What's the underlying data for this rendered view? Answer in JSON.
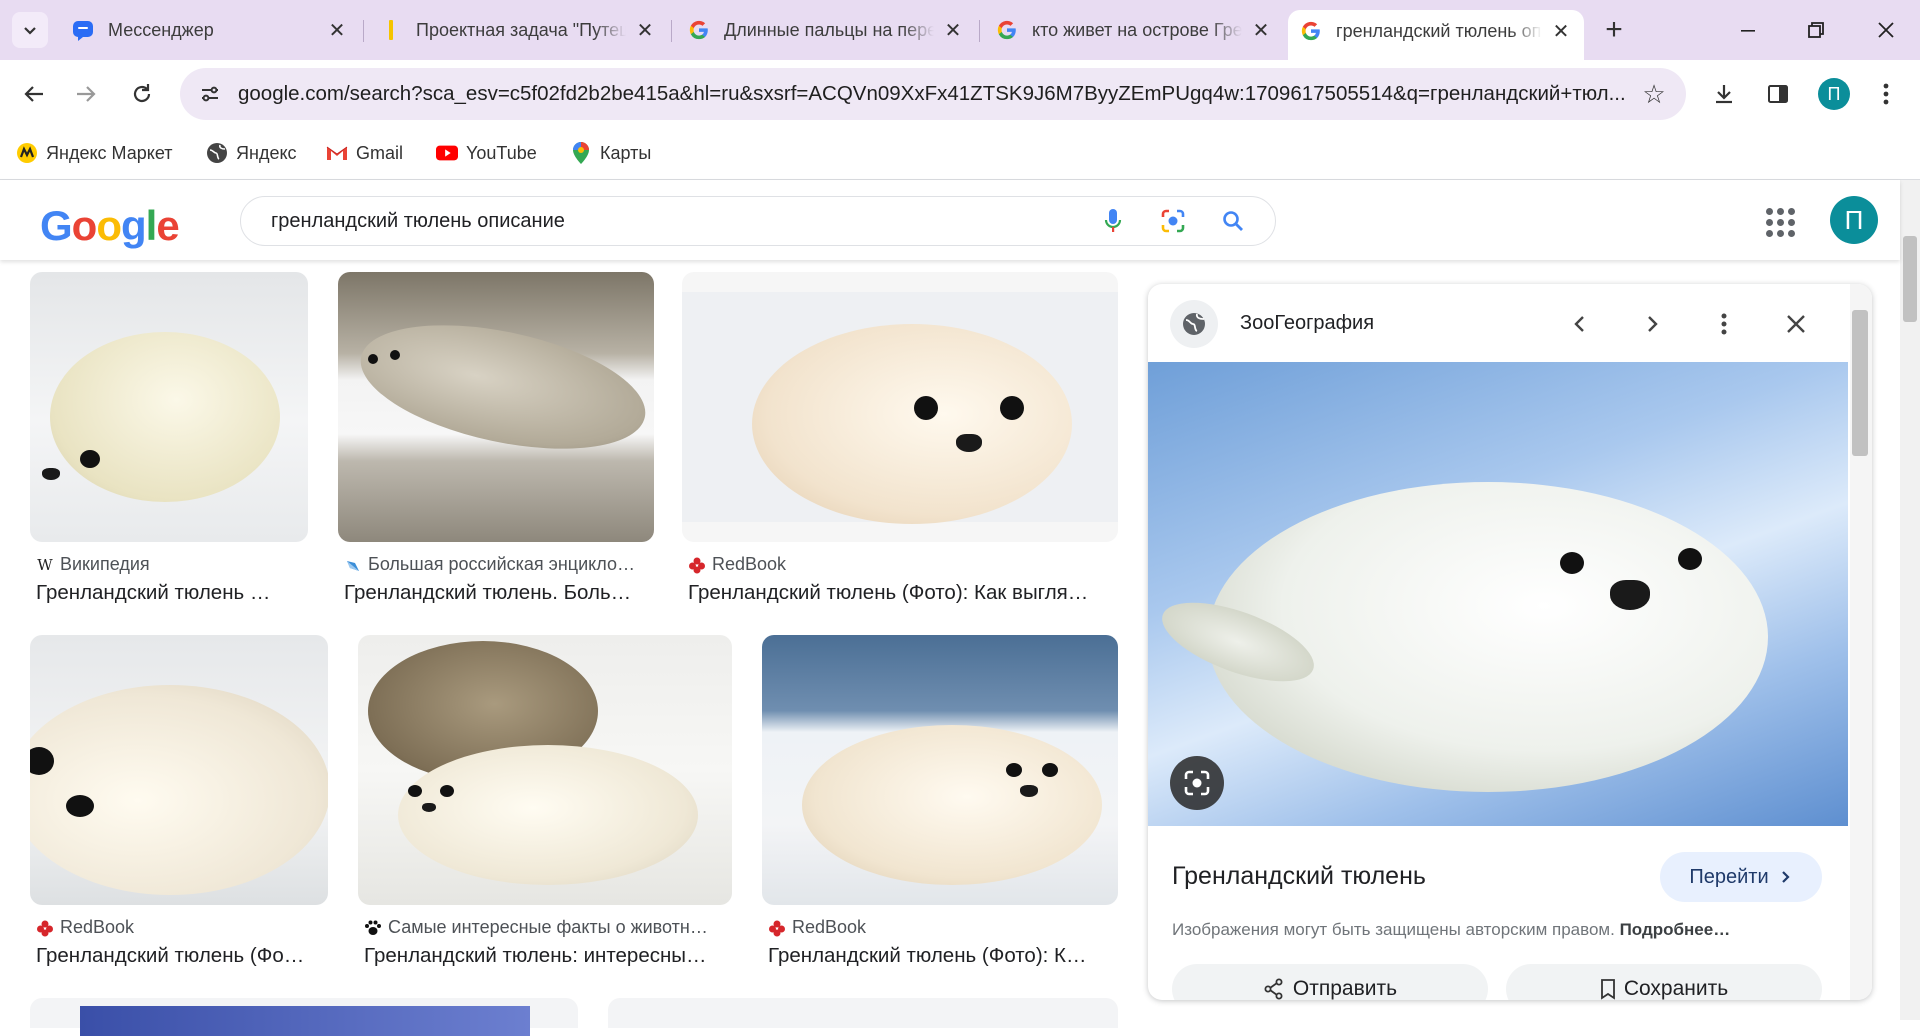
{
  "browser": {
    "tabs": [
      {
        "title": "Мессенджер",
        "icon": "messenger-icon"
      },
      {
        "title": "Проектная задача \"Путешествие\"",
        "icon": "yellow-doc-icon"
      },
      {
        "title": "Длинные пальцы на перед…",
        "icon": "google-g-icon"
      },
      {
        "title": "кто живет на острове Гренл…",
        "icon": "google-g-icon"
      },
      {
        "title": "гренландский тюлень описание",
        "icon": "google-g-icon",
        "active": true
      }
    ],
    "url": "google.com/search?sca_esv=c5f02fd2b2be415a&hl=ru&sxsrf=ACQVn09XxFx41ZTSK9J6M7ByyZEmPUgq4w:1709617505514&q=гренландский+тюл...",
    "profile_letter": "П",
    "bookmarks": [
      {
        "label": "Яндекс Маркет",
        "icon": "yandex-market-icon"
      },
      {
        "label": "Яндекс",
        "icon": "globe-icon"
      },
      {
        "label": "Gmail",
        "icon": "gmail-icon"
      },
      {
        "label": "YouTube",
        "icon": "youtube-icon"
      },
      {
        "label": "Карты",
        "icon": "maps-pin-icon"
      }
    ]
  },
  "google": {
    "logo": "Google",
    "query": "гренландский тюлень описание",
    "avatar_letter": "П"
  },
  "results": [
    {
      "source": "Википедия",
      "title": "Гренландский тюлень …",
      "source_icon": "wikipedia-icon"
    },
    {
      "source": "Большая российская энцикло…",
      "title": "Гренландский тюлень. Боль…",
      "source_icon": "bre-icon"
    },
    {
      "source": "RedBook",
      "title": "Гренландский тюлень (Фото): Как выгля…",
      "source_icon": "redbook-icon"
    },
    {
      "source": "RedBook",
      "title": "Гренландский тюлень (Фо…",
      "source_icon": "redbook-icon"
    },
    {
      "source": "Самые интересные факты о животн…",
      "title": "Гренландский тюлень: интересны…",
      "source_icon": "paw-icon"
    },
    {
      "source": "RedBook",
      "title": "Гренландский тюлень (Фото): К…",
      "source_icon": "redbook-icon"
    }
  ],
  "panel": {
    "site": "ЗооГеография",
    "title": "Гренландский тюлень",
    "visit_label": "Перейти",
    "copyright": "Изображения могут быть защищены авторским правом.",
    "more_label": "Подробнее…",
    "share_label": "Отправить",
    "save_label": "Сохранить"
  },
  "colors": {
    "tabstrip": "#e8dcf2",
    "omnibox": "#efe8f5",
    "profile": "#0b8e9a",
    "visit_button": "#e8f0fe"
  }
}
